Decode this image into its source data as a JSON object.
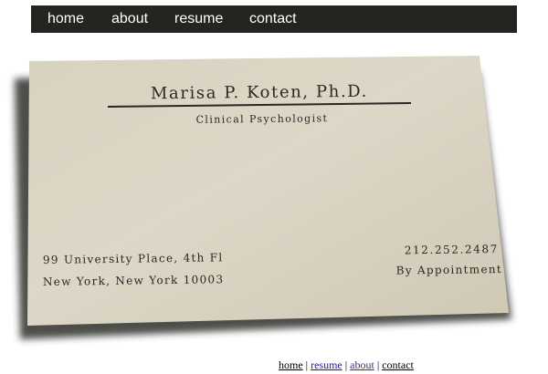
{
  "top_nav": {
    "items": [
      {
        "label": "home"
      },
      {
        "label": "about"
      },
      {
        "label": "resume"
      },
      {
        "label": "contact"
      }
    ]
  },
  "card": {
    "name": "Marisa P. Koten, Ph.D.",
    "title": "Clinical Psychologist",
    "address_line1": "99 University Place, 4th Fl",
    "address_line2": "New York, New York  10003",
    "phone": "212.252.2487",
    "availability": "By Appointment"
  },
  "bottom_nav": {
    "home": "home",
    "resume": "resume",
    "about": "about",
    "contact": "contact",
    "separator": "|"
  },
  "colors": {
    "nav_background": "#242521",
    "card_paper": "#d9d3c2",
    "card_ink": "#2a2724"
  }
}
